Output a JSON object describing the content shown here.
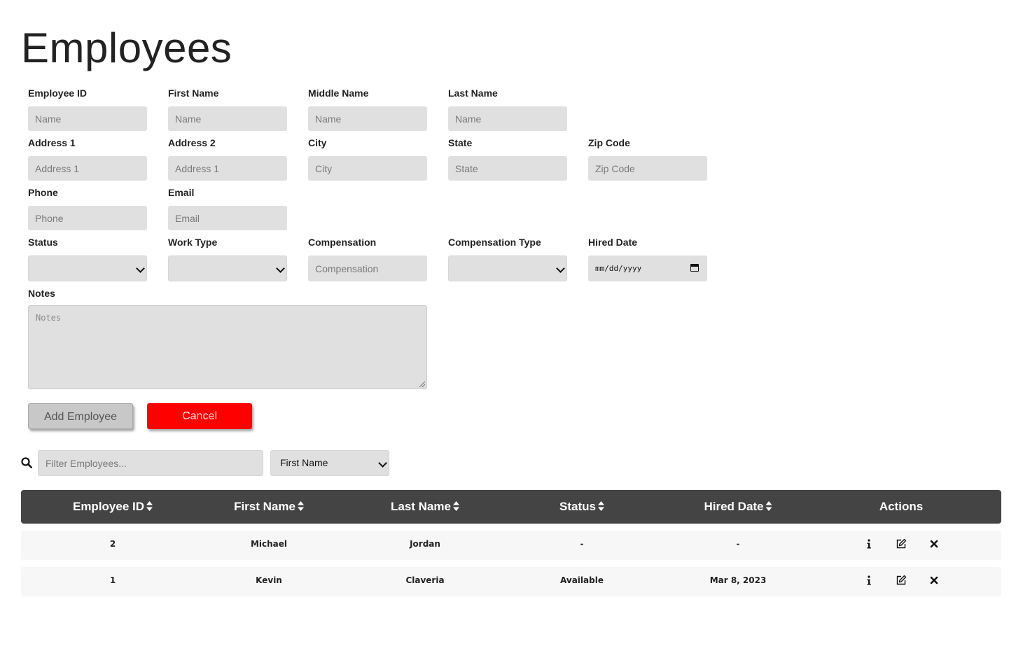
{
  "page": {
    "title": "Employees"
  },
  "form": {
    "employee_id": {
      "label": "Employee ID",
      "placeholder": "Name",
      "value": ""
    },
    "first_name": {
      "label": "First Name",
      "placeholder": "Name",
      "value": ""
    },
    "middle_name": {
      "label": "Middle Name",
      "placeholder": "Name",
      "value": ""
    },
    "last_name": {
      "label": "Last Name",
      "placeholder": "Name",
      "value": ""
    },
    "address1": {
      "label": "Address 1",
      "placeholder": "Address 1",
      "value": ""
    },
    "address2": {
      "label": "Address 2",
      "placeholder": "Address 1",
      "value": ""
    },
    "city": {
      "label": "City",
      "placeholder": "City",
      "value": ""
    },
    "state": {
      "label": "State",
      "placeholder": "State",
      "value": ""
    },
    "zip": {
      "label": "Zip Code",
      "placeholder": "Zip Code",
      "value": ""
    },
    "phone": {
      "label": "Phone",
      "placeholder": "Phone",
      "value": ""
    },
    "email": {
      "label": "Email",
      "placeholder": "Email",
      "value": ""
    },
    "status": {
      "label": "Status",
      "selected": ""
    },
    "work_type": {
      "label": "Work Type",
      "selected": ""
    },
    "compensation": {
      "label": "Compensation",
      "placeholder": "Compensation",
      "value": ""
    },
    "compensation_type": {
      "label": "Compensation Type",
      "selected": ""
    },
    "hired_date": {
      "label": "Hired Date",
      "placeholder": "mm/dd/yyyy"
    },
    "notes": {
      "label": "Notes",
      "placeholder": "Notes"
    },
    "add_button": "Add Employee",
    "cancel_button": "Cancel"
  },
  "filter": {
    "placeholder": "Filter Employees...",
    "field_selected": "First Name"
  },
  "table": {
    "headers": [
      "Employee ID",
      "First Name",
      "Last Name",
      "Status",
      "Hired Date",
      "Actions"
    ],
    "rows": [
      [
        "2",
        "Michael",
        "Jordan",
        "-",
        "-"
      ],
      [
        "1",
        "Kevin",
        "Claveria",
        "Available",
        "Mar 8, 2023"
      ]
    ]
  },
  "colors": {
    "header_bg": "#444444",
    "cancel_bg": "#ff0000",
    "input_bg": "#e0e0e0"
  },
  "icons": [
    "search-icon",
    "sort-icon",
    "info-icon",
    "edit-icon",
    "delete-icon",
    "calendar-icon",
    "chevron-down-icon"
  ]
}
